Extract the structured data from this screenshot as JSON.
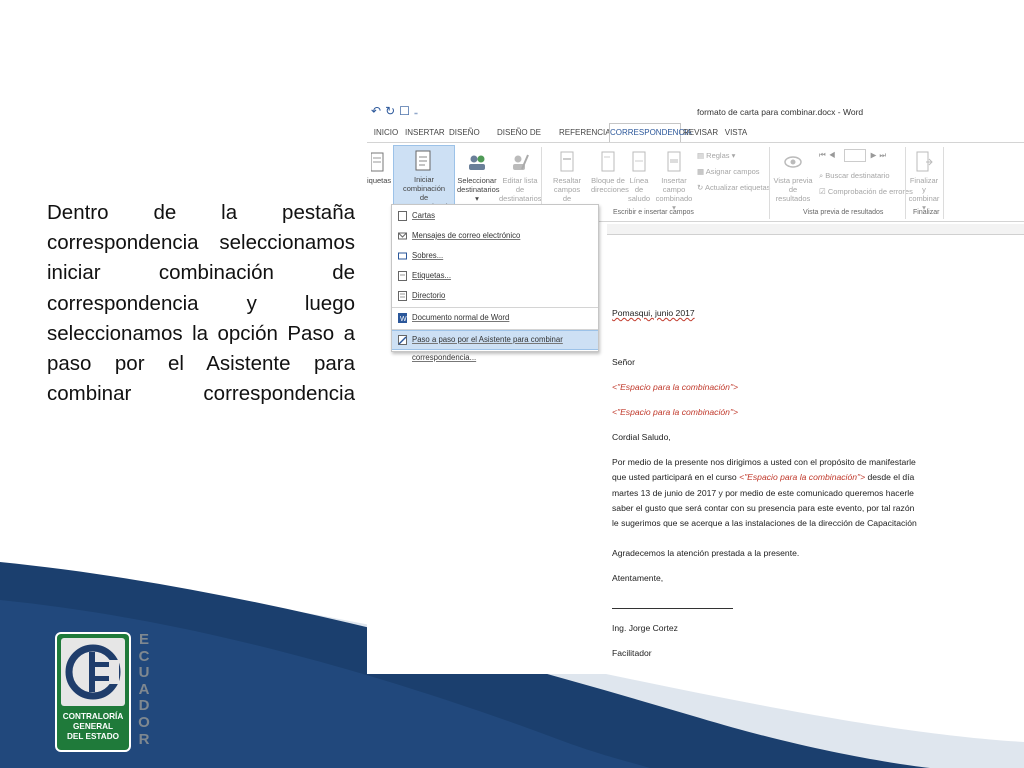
{
  "slide": {
    "explanation": "Dentro de la pestaña correspondencia seleccionamos iniciar combinación de correspondencia y luego seleccionamos la opción Paso a paso por el Asistente para combinar correspondencia",
    "logo_text_1": "CONTRALORÍA",
    "logo_text_2": "GENERAL",
    "logo_text_3": "DEL ESTADO",
    "country_letters": [
      "E",
      "C",
      "U",
      "A",
      "D",
      "O",
      "R"
    ],
    "colors": {
      "wave_dark": "#1b3f6e",
      "wave_light": "#dfe6ee",
      "logo_green": "#1f7a3a"
    }
  },
  "word": {
    "window_title": "formato de carta para combinar.docx - Word",
    "tabs": [
      "INICIO",
      "INSERTAR",
      "DISEÑO",
      "DISEÑO DE PÁGINA",
      "REFERENCIAS",
      "CORRESPONDENCIA",
      "REVISAR",
      "VISTA"
    ],
    "active_tab": "CORRESPONDENCIA",
    "ribbon": {
      "etiquetas": "iquetas",
      "iniciar_1": "Iniciar combinación",
      "iniciar_2": "de correspondencia ▾",
      "seleccionar_1": "Seleccionar",
      "seleccionar_2": "destinatarios ▾",
      "editar_1": "Editar lista de",
      "editar_2": "destinatarios",
      "resaltar_1": "Resaltar campos",
      "resaltar_2": "de combinación",
      "bloque_1": "Bloque de",
      "bloque_2": "direcciones",
      "linea_1": "Línea de",
      "linea_2": "saludo",
      "insertar_1": "Insertar campo",
      "insertar_2": "combinado ▾",
      "reglas": "Reglas ▾",
      "asignar": "Asignar campos",
      "actualizar": "Actualizar etiquetas",
      "vista_1": "Vista previa",
      "vista_2": "de resultados",
      "buscar": "Buscar destinatario",
      "comprobacion": "Comprobación de errores",
      "finalizar_1": "Finalizar y",
      "finalizar_2": "combinar ▾",
      "group_escribir": "Escribir e insertar campos",
      "group_vista": "Vista previa de resultados",
      "group_finalizar": "Finalizar"
    },
    "menu_items": [
      "Cartas",
      "Mensajes de correo electrónico",
      "Sobres...",
      "Etiquetas...",
      "Directorio",
      "Documento normal de Word",
      "Paso a paso por el Asistente para combinar correspondencia..."
    ],
    "letter": {
      "place_date": "Pomasqui, junio 2017",
      "salutation": "Señor",
      "merge_field": "<\"Espacio para la combinación\">",
      "greeting": "Cordial Saludo,",
      "body_1": "Por medio de la presente nos dirigimos a usted con el propósito de manifestarle que usted participará en el curso ",
      "body_2": " desde el día martes 13 de junio de 2017 y por medio de este comunicado queremos hacerle saber el gusto que será contar con su presencia para este evento, por tal razón le sugerimos que se acerque  a las instalaciones de la dirección de Capacitación",
      "thanks": "Agradecemos la atención prestada a la presente.",
      "closing": "Atentamente,",
      "signer": "Ing. Jorge Cortez",
      "role": "Facilitador"
    }
  }
}
